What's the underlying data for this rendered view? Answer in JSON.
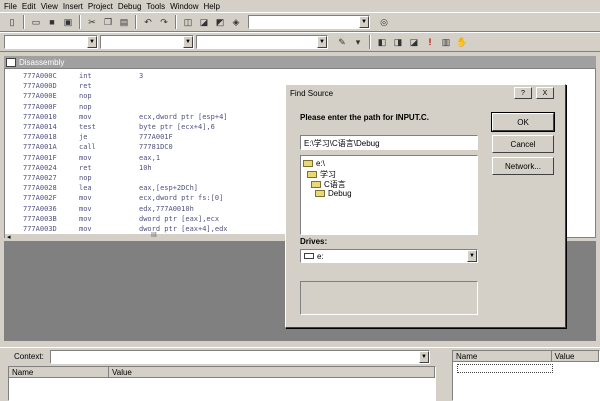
{
  "menu": [
    "File",
    "Edit",
    "View",
    "Insert",
    "Project",
    "Debug",
    "Tools",
    "Window",
    "Help"
  ],
  "menu_accel": [
    "F",
    "E",
    "V",
    "I",
    "P",
    "D",
    "T",
    "W",
    "H"
  ],
  "disassembly": {
    "title": "Disassembly",
    "rows": [
      {
        "addr": "777A000C",
        "op": "int",
        "args": "3"
      },
      {
        "addr": "777A000D",
        "op": "ret",
        "args": ""
      },
      {
        "addr": "777A000E",
        "op": "nop",
        "args": ""
      },
      {
        "addr": "777A000F",
        "op": "nop",
        "args": ""
      },
      {
        "addr": "777A0010",
        "op": "mov",
        "args": "ecx,dword ptr [esp+4]"
      },
      {
        "addr": "777A0014",
        "op": "test",
        "args": "byte ptr [ecx+4],6"
      },
      {
        "addr": "777A0018",
        "op": "je",
        "args": "777A001F"
      },
      {
        "addr": "777A001A",
        "op": "call",
        "args": "77781DC0"
      },
      {
        "addr": "777A001F",
        "op": "mov",
        "args": "eax,1"
      },
      {
        "addr": "777A0024",
        "op": "ret",
        "args": "10h"
      },
      {
        "addr": "777A0027",
        "op": "nop",
        "args": ""
      },
      {
        "addr": "777A0028",
        "op": "lea",
        "args": "eax,[esp+2DCh]"
      },
      {
        "addr": "777A002F",
        "op": "mov",
        "args": "ecx,dword ptr fs:[0]"
      },
      {
        "addr": "777A0036",
        "op": "mov",
        "args": "edx,777A0010h"
      },
      {
        "addr": "777A003B",
        "op": "mov",
        "args": "dword ptr [eax],ecx"
      },
      {
        "addr": "777A003D",
        "op": "mov",
        "args": "dword ptr [eax+4],edx"
      }
    ]
  },
  "dialog": {
    "title": "Find Source",
    "help_btn": "?",
    "close_btn": "X",
    "prompt": "Please enter the path for INPUT.C.",
    "path_value": "E:\\学习\\C语言\\Debug",
    "tree": [
      "e:\\",
      "学习",
      "C语言",
      "Debug"
    ],
    "drives_label": "Drives:",
    "drive_value": "e:",
    "ok": "OK",
    "cancel": "Cancel",
    "network": "Network..."
  },
  "bottom": {
    "context_label": "Context:",
    "left_cols": [
      "Name",
      "Value"
    ],
    "right_cols": [
      "Name",
      "Value"
    ]
  },
  "colors": {
    "code_text": "#505080",
    "title_inactive": "#a0a0a0"
  }
}
